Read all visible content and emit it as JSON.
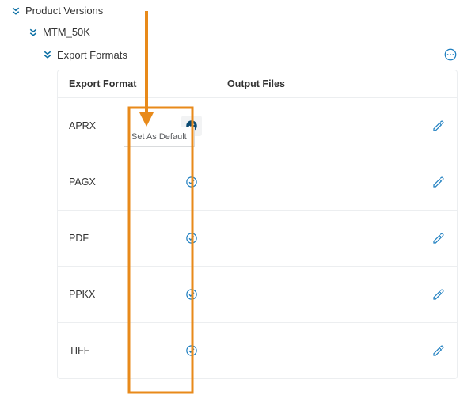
{
  "colors": {
    "brand_blue": "#0b6fa4",
    "accent_orange": "#e88a1a",
    "edit_blue": "#1b7dbf"
  },
  "tree": {
    "root_label": "Product Versions",
    "version_label": "MTM_50K",
    "formats_label": "Export Formats"
  },
  "table": {
    "header_format": "Export Format",
    "header_output": "Output Files",
    "rows": [
      {
        "format": "APRX",
        "is_default": true,
        "output": ""
      },
      {
        "format": "PAGX",
        "is_default": false,
        "output": ""
      },
      {
        "format": "PDF",
        "is_default": false,
        "output": ""
      },
      {
        "format": "PPKX",
        "is_default": false,
        "output": ""
      },
      {
        "format": "TIFF",
        "is_default": false,
        "output": ""
      }
    ]
  },
  "tooltip_text": "Set As Default"
}
